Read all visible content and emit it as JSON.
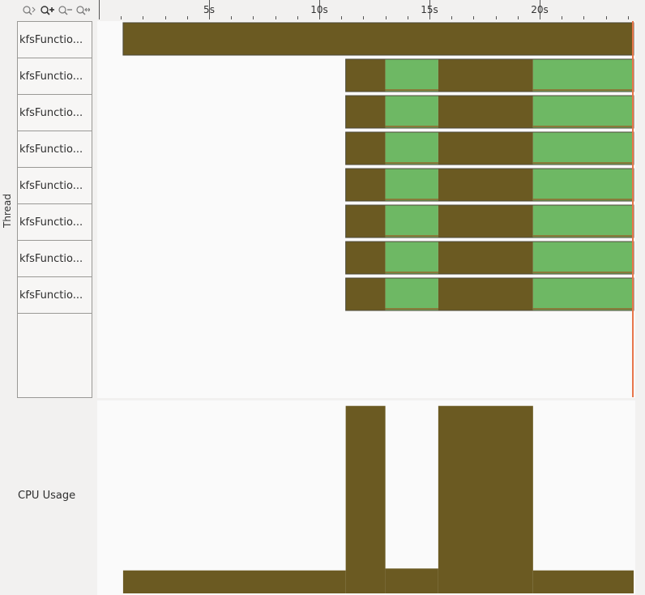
{
  "toolbar": {
    "buttons": [
      {
        "name": "zoom-fit-icon",
        "glyph": "fit"
      },
      {
        "name": "zoom-in-icon",
        "glyph": "+"
      },
      {
        "name": "zoom-out-icon",
        "glyph": "-"
      },
      {
        "name": "zoom-reset-icon",
        "glyph": "reset"
      }
    ]
  },
  "ruler": {
    "ticks": [
      {
        "label": "5s",
        "t": 5
      },
      {
        "label": "10s",
        "t": 10
      },
      {
        "label": "15s",
        "t": 15
      },
      {
        "label": "20s",
        "t": 20
      }
    ],
    "t_end": 24
  },
  "axis": {
    "thread_label": "Thread"
  },
  "threads": [
    {
      "label": "kfsFunctio...",
      "segments": [
        {
          "start": 1.1,
          "end": 24.3,
          "state": "running"
        }
      ]
    },
    {
      "label": "kfsFunctio...",
      "segments": [
        {
          "start": 11.2,
          "end": 13.0,
          "state": "running"
        },
        {
          "start": 13.0,
          "end": 15.4,
          "state": "waiting"
        },
        {
          "start": 15.4,
          "end": 19.7,
          "state": "running"
        },
        {
          "start": 19.7,
          "end": 24.3,
          "state": "waiting"
        }
      ]
    },
    {
      "label": "kfsFunctio...",
      "segments": [
        {
          "start": 11.2,
          "end": 13.0,
          "state": "running"
        },
        {
          "start": 13.0,
          "end": 15.4,
          "state": "waiting"
        },
        {
          "start": 15.4,
          "end": 19.7,
          "state": "running"
        },
        {
          "start": 19.7,
          "end": 24.3,
          "state": "waiting"
        }
      ]
    },
    {
      "label": "kfsFunctio...",
      "segments": [
        {
          "start": 11.2,
          "end": 13.0,
          "state": "running"
        },
        {
          "start": 13.0,
          "end": 15.4,
          "state": "waiting"
        },
        {
          "start": 15.4,
          "end": 19.7,
          "state": "running"
        },
        {
          "start": 19.7,
          "end": 24.3,
          "state": "waiting"
        }
      ]
    },
    {
      "label": "kfsFunctio...",
      "segments": [
        {
          "start": 11.2,
          "end": 13.0,
          "state": "running"
        },
        {
          "start": 13.0,
          "end": 15.4,
          "state": "waiting"
        },
        {
          "start": 15.4,
          "end": 19.7,
          "state": "running"
        },
        {
          "start": 19.7,
          "end": 24.3,
          "state": "waiting"
        }
      ]
    },
    {
      "label": "kfsFunctio...",
      "segments": [
        {
          "start": 11.2,
          "end": 13.0,
          "state": "running"
        },
        {
          "start": 13.0,
          "end": 15.4,
          "state": "waiting"
        },
        {
          "start": 15.4,
          "end": 19.7,
          "state": "running"
        },
        {
          "start": 19.7,
          "end": 24.3,
          "state": "waiting"
        }
      ]
    },
    {
      "label": "kfsFunctio...",
      "segments": [
        {
          "start": 11.2,
          "end": 13.0,
          "state": "running"
        },
        {
          "start": 13.0,
          "end": 15.4,
          "state": "waiting"
        },
        {
          "start": 15.4,
          "end": 19.7,
          "state": "running"
        },
        {
          "start": 19.7,
          "end": 24.3,
          "state": "waiting"
        }
      ]
    },
    {
      "label": "kfsFunctio...",
      "segments": [
        {
          "start": 11.2,
          "end": 13.0,
          "state": "running"
        },
        {
          "start": 13.0,
          "end": 15.4,
          "state": "waiting"
        },
        {
          "start": 15.4,
          "end": 19.7,
          "state": "running"
        },
        {
          "start": 19.7,
          "end": 24.3,
          "state": "waiting"
        }
      ]
    }
  ],
  "cpu": {
    "label": "CPU Usage",
    "series": [
      {
        "start": 1.1,
        "end": 11.2,
        "level": 0.12
      },
      {
        "start": 11.2,
        "end": 13.0,
        "level": 0.98
      },
      {
        "start": 13.0,
        "end": 15.4,
        "level": 0.13
      },
      {
        "start": 15.4,
        "end": 19.7,
        "level": 0.98
      },
      {
        "start": 19.7,
        "end": 24.3,
        "level": 0.12
      }
    ]
  },
  "colors": {
    "running": "#6b5a22",
    "waiting": "#6eb864",
    "cursor": "#e8764b"
  }
}
